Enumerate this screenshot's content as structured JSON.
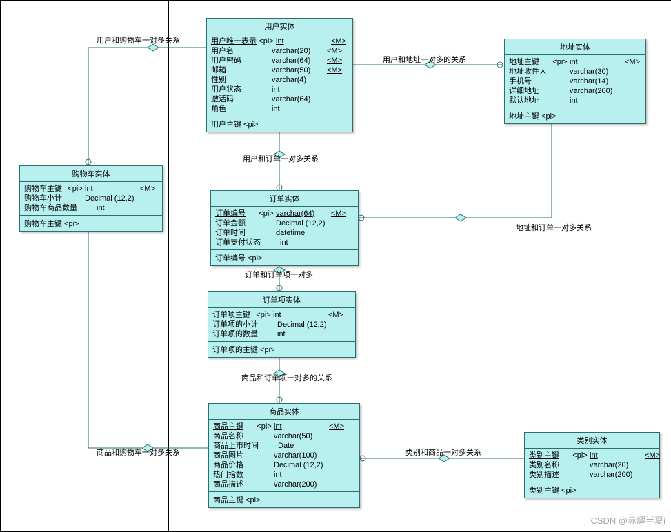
{
  "entities": {
    "user": {
      "title": "用户实体",
      "rows": [
        {
          "name": "用户唯一表示",
          "pi": "<pi>",
          "type": "int",
          "m": "<M>",
          "u": true
        },
        {
          "name": "用户名",
          "pi": "",
          "type": "varchar(20)",
          "m": "<M>"
        },
        {
          "name": "用户密码",
          "pi": "",
          "type": "varchar(64)",
          "m": "<M>"
        },
        {
          "name": "邮箱",
          "pi": "",
          "type": "varchar(50)",
          "m": "<M>"
        },
        {
          "name": "性别",
          "pi": "",
          "type": "varchar(4)",
          "m": ""
        },
        {
          "name": "用户状态",
          "pi": "",
          "type": "int",
          "m": ""
        },
        {
          "name": "激活码",
          "pi": "",
          "type": "varchar(64)",
          "m": ""
        },
        {
          "name": "角色",
          "pi": "",
          "type": "int",
          "m": ""
        }
      ],
      "foot": "用户主键 <pi>"
    },
    "address": {
      "title": "地址实体",
      "rows": [
        {
          "name": "地址主键",
          "pi": "<pi>",
          "type": "int",
          "m": "<M>",
          "u": true
        },
        {
          "name": "地址收件人",
          "pi": "",
          "type": "varchar(30)",
          "m": ""
        },
        {
          "name": "手机号",
          "pi": "",
          "type": "varchar(14)",
          "m": ""
        },
        {
          "name": "详细地址",
          "pi": "",
          "type": "varchar(200)",
          "m": ""
        },
        {
          "name": "默认地址",
          "pi": "",
          "type": "int",
          "m": ""
        }
      ],
      "foot": "地址主键 <pi>"
    },
    "cart": {
      "title": "购物车实体",
      "rows": [
        {
          "name": "购物车主键",
          "pi": "<pi>",
          "type": "int",
          "m": "<M>",
          "u": true
        },
        {
          "name": "购物车小计",
          "pi": "",
          "type": "Decimal (12,2)",
          "m": ""
        },
        {
          "name": "购物车商品数量",
          "pi": "",
          "type": "int",
          "m": ""
        }
      ],
      "foot": "购物车主键 <pi>"
    },
    "order": {
      "title": "订单实体",
      "rows": [
        {
          "name": "订单编号",
          "pi": "<pi>",
          "type": "varchar(64)",
          "m": "<M>",
          "u": true
        },
        {
          "name": "订单金额",
          "pi": "",
          "type": "Decimal (12,2)",
          "m": ""
        },
        {
          "name": "订单时间",
          "pi": "",
          "type": "datetime",
          "m": ""
        },
        {
          "name": "订单支付状态",
          "pi": "",
          "type": "int",
          "m": ""
        }
      ],
      "foot": "订单编号 <pi>"
    },
    "orderitem": {
      "title": "订单项实体",
      "rows": [
        {
          "name": "订单项主键",
          "pi": "<pi>",
          "type": "int",
          "m": "<M>",
          "u": true
        },
        {
          "name": "订单项的小计",
          "pi": "",
          "type": "Decimal (12,2)",
          "m": ""
        },
        {
          "name": "订单项的数量",
          "pi": "",
          "type": "int",
          "m": ""
        }
      ],
      "foot": "订单项的主键 <pi>"
    },
    "product": {
      "title": "商品实体",
      "rows": [
        {
          "name": "商品主键",
          "pi": "<pi>",
          "type": "int",
          "m": "<M>",
          "u": true
        },
        {
          "name": "商品名称",
          "pi": "",
          "type": "varchar(50)",
          "m": ""
        },
        {
          "name": "商品上市时间",
          "pi": "",
          "type": "Date",
          "m": ""
        },
        {
          "name": "商品图片",
          "pi": "",
          "type": "varchar(100)",
          "m": ""
        },
        {
          "name": "商品价格",
          "pi": "",
          "type": "Decimal (12,2)",
          "m": ""
        },
        {
          "name": "热门指数",
          "pi": "",
          "type": "int",
          "m": ""
        },
        {
          "name": "商品描述",
          "pi": "",
          "type": "varchar(200)",
          "m": ""
        }
      ],
      "foot": "商品主键 <pi>"
    },
    "category": {
      "title": "类别实体",
      "rows": [
        {
          "name": "类别主键",
          "pi": "<pi>",
          "type": "int",
          "m": "<M>",
          "u": true
        },
        {
          "name": "类别名称",
          "pi": "",
          "type": "varchar(20)",
          "m": ""
        },
        {
          "name": "类别描述",
          "pi": "",
          "type": "varchar(200)",
          "m": ""
        }
      ],
      "foot": "类别主键 <pi>"
    }
  },
  "relations": {
    "user_cart": "用户和购物车一对多关系",
    "user_address": "用户和地址一对多的关系",
    "user_order": "用户和订单一对多关系",
    "address_order": "地址和订单一对多关系",
    "order_item": "订单和订单项一对多",
    "product_item": "商品和订单项一对多的关系",
    "product_cart": "商品和购物车一对多关系",
    "category_product": "类别和商品一对多关系"
  },
  "watermark": "CSDN @赤耀半夏i",
  "chart_data": {
    "type": "diagram",
    "diagram_type": "entity-relationship (conceptual data model)",
    "entities": [
      {
        "name": "用户实体",
        "pk": "用户主键",
        "attributes": [
          {
            "name": "用户唯一表示",
            "type": "int",
            "pi": true,
            "mandatory": true
          },
          {
            "name": "用户名",
            "type": "varchar(20)",
            "mandatory": true
          },
          {
            "name": "用户密码",
            "type": "varchar(64)",
            "mandatory": true
          },
          {
            "name": "邮箱",
            "type": "varchar(50)",
            "mandatory": true
          },
          {
            "name": "性别",
            "type": "varchar(4)"
          },
          {
            "name": "用户状态",
            "type": "int"
          },
          {
            "name": "激活码",
            "type": "varchar(64)"
          },
          {
            "name": "角色",
            "type": "int"
          }
        ]
      },
      {
        "name": "地址实体",
        "pk": "地址主键",
        "attributes": [
          {
            "name": "地址主键",
            "type": "int",
            "pi": true,
            "mandatory": true
          },
          {
            "name": "地址收件人",
            "type": "varchar(30)"
          },
          {
            "name": "手机号",
            "type": "varchar(14)"
          },
          {
            "name": "详细地址",
            "type": "varchar(200)"
          },
          {
            "name": "默认地址",
            "type": "int"
          }
        ]
      },
      {
        "name": "购物车实体",
        "pk": "购物车主键",
        "attributes": [
          {
            "name": "购物车主键",
            "type": "int",
            "pi": true,
            "mandatory": true
          },
          {
            "name": "购物车小计",
            "type": "Decimal(12,2)"
          },
          {
            "name": "购物车商品数量",
            "type": "int"
          }
        ]
      },
      {
        "name": "订单实体",
        "pk": "订单编号",
        "attributes": [
          {
            "name": "订单编号",
            "type": "varchar(64)",
            "pi": true,
            "mandatory": true
          },
          {
            "name": "订单金额",
            "type": "Decimal(12,2)"
          },
          {
            "name": "订单时间",
            "type": "datetime"
          },
          {
            "name": "订单支付状态",
            "type": "int"
          }
        ]
      },
      {
        "name": "订单项实体",
        "pk": "订单项的主键",
        "attributes": [
          {
            "name": "订单项主键",
            "type": "int",
            "pi": true,
            "mandatory": true
          },
          {
            "name": "订单项的小计",
            "type": "Decimal(12,2)"
          },
          {
            "name": "订单项的数量",
            "type": "int"
          }
        ]
      },
      {
        "name": "商品实体",
        "pk": "商品主键",
        "attributes": [
          {
            "name": "商品主键",
            "type": "int",
            "pi": true,
            "mandatory": true
          },
          {
            "name": "商品名称",
            "type": "varchar(50)"
          },
          {
            "name": "商品上市时间",
            "type": "Date"
          },
          {
            "name": "商品图片",
            "type": "varchar(100)"
          },
          {
            "name": "商品价格",
            "type": "Decimal(12,2)"
          },
          {
            "name": "热门指数",
            "type": "int"
          },
          {
            "name": "商品描述",
            "type": "varchar(200)"
          }
        ]
      },
      {
        "name": "类别实体",
        "pk": "类别主键",
        "attributes": [
          {
            "name": "类别主键",
            "type": "int",
            "pi": true,
            "mandatory": true
          },
          {
            "name": "类别名称",
            "type": "varchar(20)"
          },
          {
            "name": "类别描述",
            "type": "varchar(200)"
          }
        ]
      }
    ],
    "relationships": [
      {
        "name": "用户和购物车一对多关系",
        "from": "用户实体",
        "to": "购物车实体",
        "cardinality": "1:N"
      },
      {
        "name": "用户和地址一对多的关系",
        "from": "用户实体",
        "to": "地址实体",
        "cardinality": "1:N"
      },
      {
        "name": "用户和订单一对多关系",
        "from": "用户实体",
        "to": "订单实体",
        "cardinality": "1:N"
      },
      {
        "name": "地址和订单一对多关系",
        "from": "地址实体",
        "to": "订单实体",
        "cardinality": "1:N"
      },
      {
        "name": "订单和订单项一对多",
        "from": "订单实体",
        "to": "订单项实体",
        "cardinality": "1:N"
      },
      {
        "name": "商品和订单项一对多的关系",
        "from": "商品实体",
        "to": "订单项实体",
        "cardinality": "1:N"
      },
      {
        "name": "商品和购物车一对多关系",
        "from": "商品实体",
        "to": "购物车实体",
        "cardinality": "1:N"
      },
      {
        "name": "类别和商品一对多关系",
        "from": "类别实体",
        "to": "商品实体",
        "cardinality": "1:N"
      }
    ]
  }
}
